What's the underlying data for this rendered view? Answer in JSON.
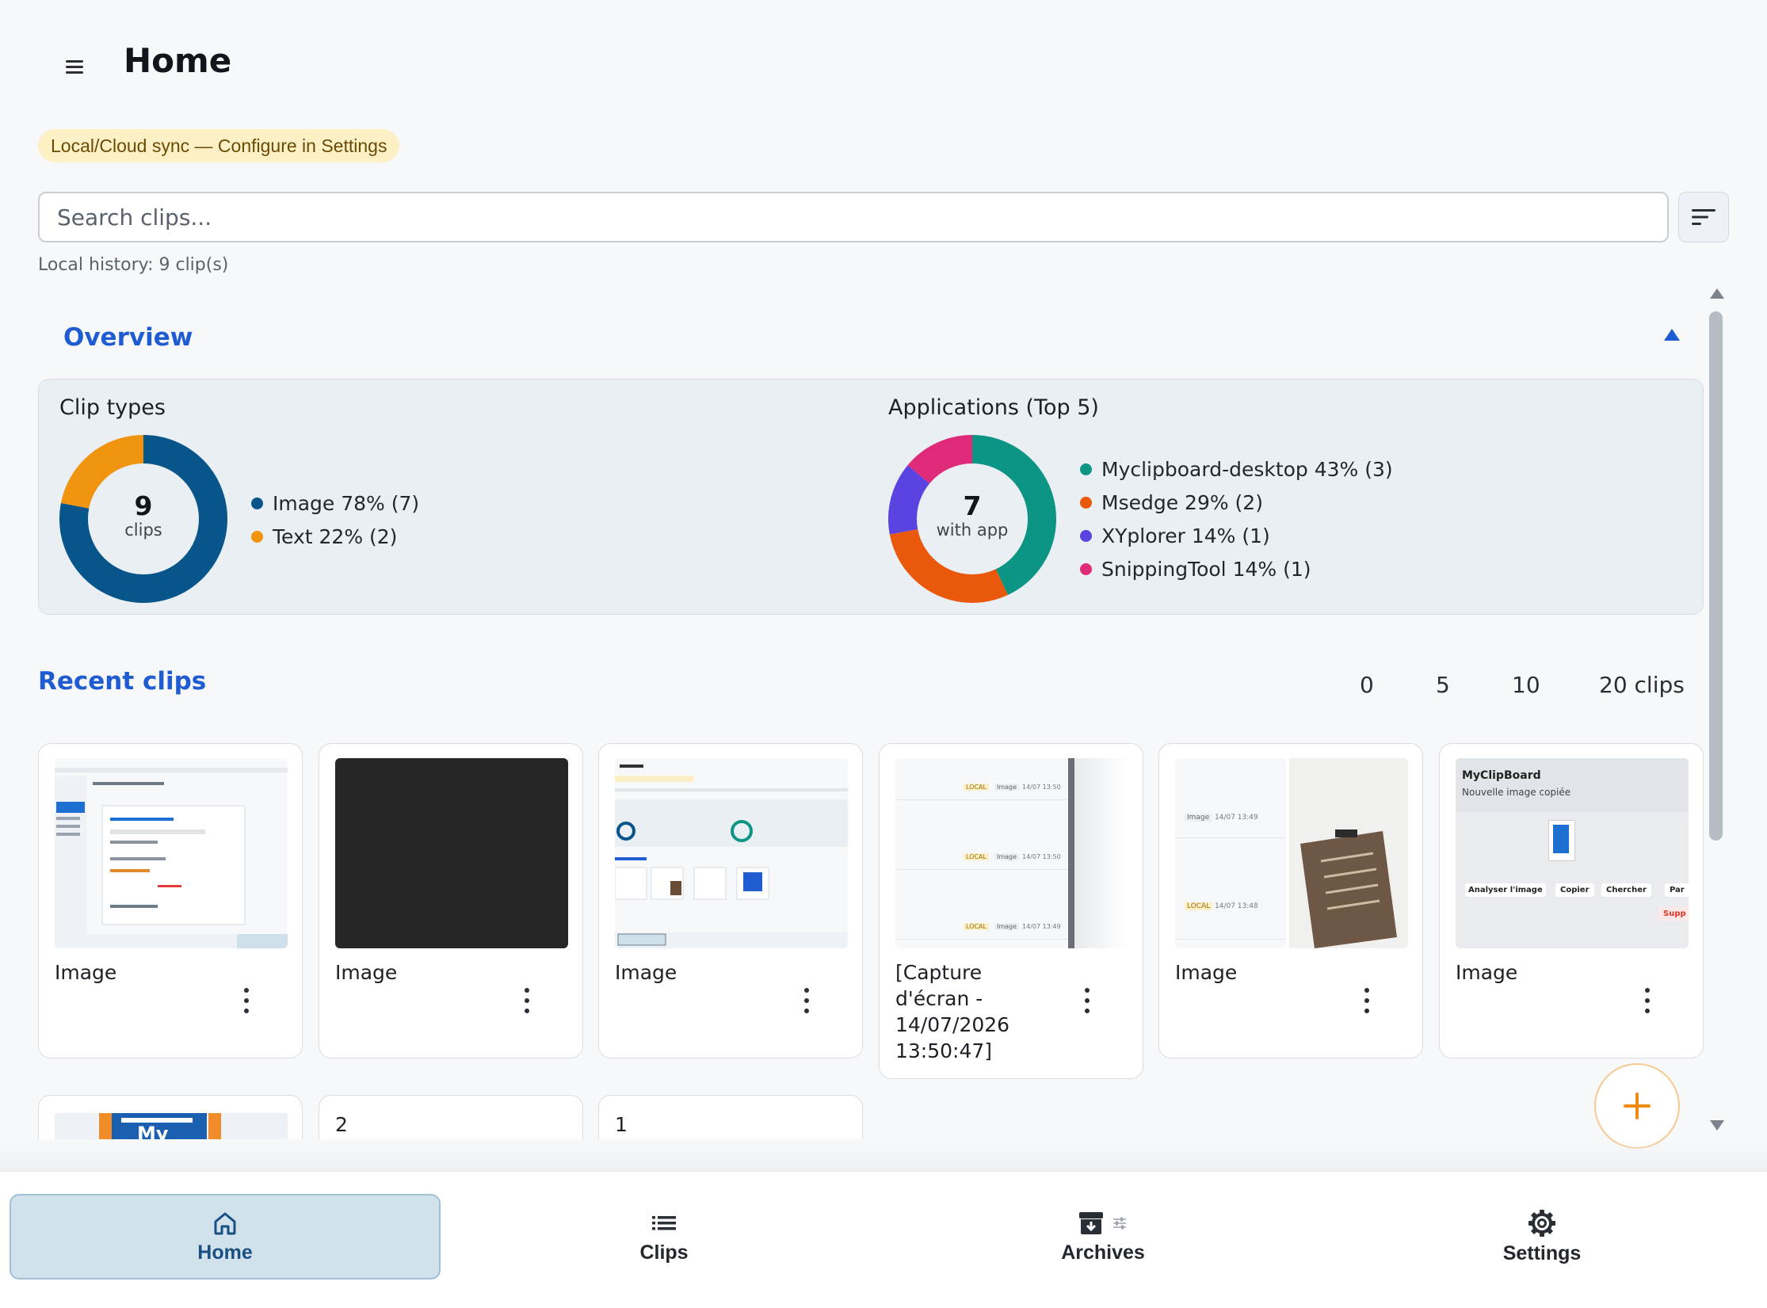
{
  "header": {
    "title": "Home",
    "menu_icon": "hamburger-menu-icon"
  },
  "sync_badge": "Local/Cloud sync — Configure in Settings",
  "search": {
    "placeholder": "Search clips...",
    "value": ""
  },
  "history_text": "Local history: 9 clip(s)",
  "overview": {
    "title": "Overview",
    "clip_types": {
      "title": "Clip types",
      "center_value": "9",
      "center_label": "clips",
      "chart_data": {
        "type": "pie",
        "categories": [
          "Image",
          "Text"
        ],
        "values": [
          78,
          22
        ],
        "counts": [
          7,
          2
        ],
        "colors": [
          "#07558a",
          "#f09410"
        ],
        "legend": [
          "Image 78% (7)",
          "Text 22% (2)"
        ]
      }
    },
    "applications": {
      "title": "Applications (Top 5)",
      "center_value": "7",
      "center_label": "with app",
      "chart_data": {
        "type": "pie",
        "categories": [
          "Myclipboard-desktop",
          "Msedge",
          "XYplorer",
          "SnippingTool"
        ],
        "values": [
          43,
          29,
          14,
          14
        ],
        "counts": [
          3,
          2,
          1,
          1
        ],
        "colors": [
          "#0c9484",
          "#ea580c",
          "#5a43e0",
          "#de2a78"
        ],
        "legend": [
          "Myclipboard-desktop 43% (3)",
          "Msedge 29% (2)",
          "XYplorer 14% (1)",
          "SnippingTool 14% (1)"
        ]
      }
    }
  },
  "recent": {
    "title": "Recent clips",
    "count_options": [
      "0",
      "5",
      "10",
      "20 clips"
    ],
    "cards": [
      {
        "label": "Image"
      },
      {
        "label": "Image"
      },
      {
        "label": "Image"
      },
      {
        "label": "[Capture d'écran - 14/07/2026 13:50:47]"
      },
      {
        "label": "Image"
      },
      {
        "label": "Image"
      }
    ],
    "row2": [
      {
        "label": ""
      },
      {
        "label": "2"
      },
      {
        "label": "1"
      }
    ],
    "thumb_texts": {
      "card4": {
        "tag": "LOCAL",
        "type": "Image",
        "t1": "14/07 13:50",
        "t2": "14/07 13:50",
        "t3": "14/07 13:49"
      },
      "card5": {
        "type": "Image",
        "tag": "LOCAL",
        "t1": "14/07 13:49",
        "t2": "14/07 13:48"
      },
      "card6": {
        "app": "MyClipBoard",
        "msg": "Nouvelle image copiée",
        "b1": "Analyser l'image",
        "b2": "Copier",
        "b3": "Chercher",
        "b4": "Par",
        "b5": "Supp"
      },
      "card7": {
        "logo_text": "My"
      }
    }
  },
  "bottom_nav": [
    {
      "label": "Home",
      "icon": "home-icon",
      "active": true
    },
    {
      "label": "Clips",
      "icon": "list-icon",
      "active": false
    },
    {
      "label": "Archives",
      "icon": "archive-icon",
      "active": false
    },
    {
      "label": "Settings",
      "icon": "gear-icon",
      "active": false
    }
  ]
}
